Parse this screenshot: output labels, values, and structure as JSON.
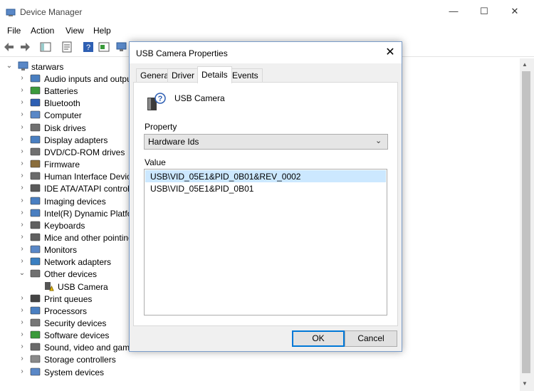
{
  "window": {
    "title": "Device Manager",
    "controls": {
      "minimize": "—",
      "maximize": "☐",
      "close": "✕"
    }
  },
  "menu": [
    "File",
    "Action",
    "View",
    "Help"
  ],
  "tree": {
    "root": "starwars",
    "items": [
      {
        "label": "Audio inputs and outpu",
        "icon": "audio-icon"
      },
      {
        "label": "Batteries",
        "icon": "battery-icon"
      },
      {
        "label": "Bluetooth",
        "icon": "bluetooth-icon"
      },
      {
        "label": "Computer",
        "icon": "computer-icon"
      },
      {
        "label": "Disk drives",
        "icon": "disk-icon"
      },
      {
        "label": "Display adapters",
        "icon": "display-adapter-icon"
      },
      {
        "label": "DVD/CD-ROM drives",
        "icon": "dvd-icon"
      },
      {
        "label": "Firmware",
        "icon": "firmware-icon"
      },
      {
        "label": "Human Interface Device",
        "icon": "hid-icon"
      },
      {
        "label": "IDE ATA/ATAPI controlle",
        "icon": "ide-icon"
      },
      {
        "label": "Imaging devices",
        "icon": "camera-icon"
      },
      {
        "label": "Intel(R) Dynamic Platfor",
        "icon": "chip-icon"
      },
      {
        "label": "Keyboards",
        "icon": "keyboard-icon"
      },
      {
        "label": "Mice and other pointing",
        "icon": "mouse-icon"
      },
      {
        "label": "Monitors",
        "icon": "monitor-icon"
      },
      {
        "label": "Network adapters",
        "icon": "network-icon"
      },
      {
        "label": "Other devices",
        "icon": "other-devices-icon",
        "expanded": true
      },
      {
        "label": "USB Camera",
        "icon": "warning-device-icon",
        "child": true
      },
      {
        "label": "Print queues",
        "icon": "printer-icon"
      },
      {
        "label": "Processors",
        "icon": "processor-icon"
      },
      {
        "label": "Security devices",
        "icon": "security-icon"
      },
      {
        "label": "Software devices",
        "icon": "software-icon"
      },
      {
        "label": "Sound, video and game",
        "icon": "sound-icon"
      },
      {
        "label": "Storage controllers",
        "icon": "storage-icon"
      },
      {
        "label": "System devices",
        "icon": "system-icon"
      }
    ]
  },
  "dialog": {
    "title": "USB Camera Properties",
    "tabs": [
      "General",
      "Driver",
      "Details",
      "Events"
    ],
    "active_tab": "Details",
    "device_name": "USB Camera",
    "property_label": "Property",
    "property_value": "Hardware Ids",
    "value_label": "Value",
    "values": [
      "USB\\VID_05E1&PID_0B01&REV_0002",
      "USB\\VID_05E1&PID_0B01"
    ],
    "ok_label": "OK",
    "cancel_label": "Cancel"
  },
  "colors": {
    "selection": "#cce8ff",
    "accent": "#0078d7",
    "dialog_bg": "#f0f0f0"
  }
}
